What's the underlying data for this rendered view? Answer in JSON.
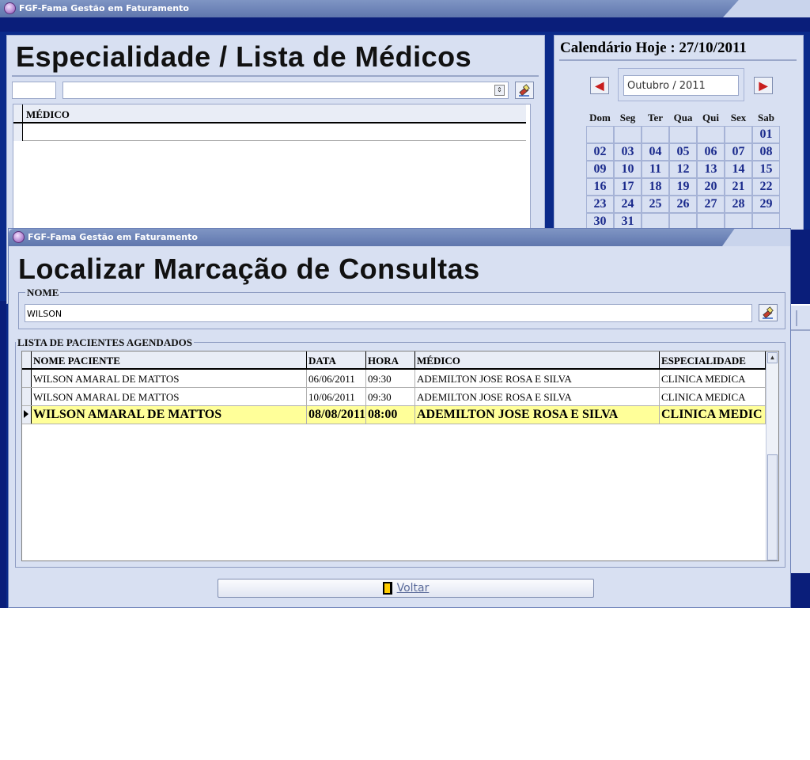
{
  "back_window": {
    "title": "FGF-Fama Gestão em Faturamento",
    "heading": "Especialidade / Lista de Médicos",
    "medicos_grid": {
      "column_medico": "MÉDICO"
    },
    "calendar": {
      "title": "Calendário Hoje : 27/10/2011",
      "month_label": "Outubro / 2011",
      "prev_icon": "arrow-left-icon",
      "next_icon": "arrow-right-icon",
      "weekdays": [
        "Dom",
        "Seg",
        "Ter",
        "Qua",
        "Qui",
        "Sex",
        "Sab"
      ],
      "weeks": [
        [
          "",
          "",
          "",
          "",
          "",
          "",
          "01"
        ],
        [
          "02",
          "03",
          "04",
          "05",
          "06",
          "07",
          "08"
        ],
        [
          "09",
          "10",
          "11",
          "12",
          "13",
          "14",
          "15"
        ],
        [
          "16",
          "17",
          "18",
          "19",
          "20",
          "21",
          "22"
        ],
        [
          "23",
          "24",
          "25",
          "26",
          "27",
          "28",
          "29"
        ],
        [
          "30",
          "31",
          "",
          "",
          "",
          "",
          ""
        ]
      ]
    }
  },
  "front_window": {
    "title": "FGF-Fama Gestão em Faturamento",
    "heading": "Localizar Marcação de Consultas",
    "nome_group_label": "NOME",
    "nome_value": "WILSON",
    "list_group_label": "LISTA DE PACIENTES AGENDADOS",
    "columns": {
      "nome_paciente": "NOME PACIENTE",
      "data": "DATA",
      "hora": "HORA",
      "medico": "MÉDICO",
      "especialidade": "ESPECIALIDADE"
    },
    "rows": [
      {
        "nome": "WILSON AMARAL DE MATTOS",
        "data": "06/06/2011",
        "hora": "09:30",
        "medico": "ADEMILTON JOSE ROSA E SILVA",
        "especialidade": "CLINICA MEDICA"
      },
      {
        "nome": "WILSON AMARAL DE MATTOS",
        "data": "10/06/2011",
        "hora": "09:30",
        "medico": "ADEMILTON JOSE ROSA E SILVA",
        "especialidade": "CLINICA MEDICA"
      },
      {
        "nome": "WILSON AMARAL DE MATTOS",
        "data": "08/08/2011",
        "hora": "08:00",
        "medico": "ADEMILTON JOSE ROSA E SILVA",
        "especialidade": "CLINICA MEDIC"
      }
    ],
    "selected_row_color": "#ffff99",
    "voltar_label": "Voltar"
  },
  "colors": {
    "window_bg": "#d8e0f2",
    "navy": "#0a1e7a",
    "calendar_text": "#1a2a8c",
    "nav_arrow": "#c81e1e"
  }
}
